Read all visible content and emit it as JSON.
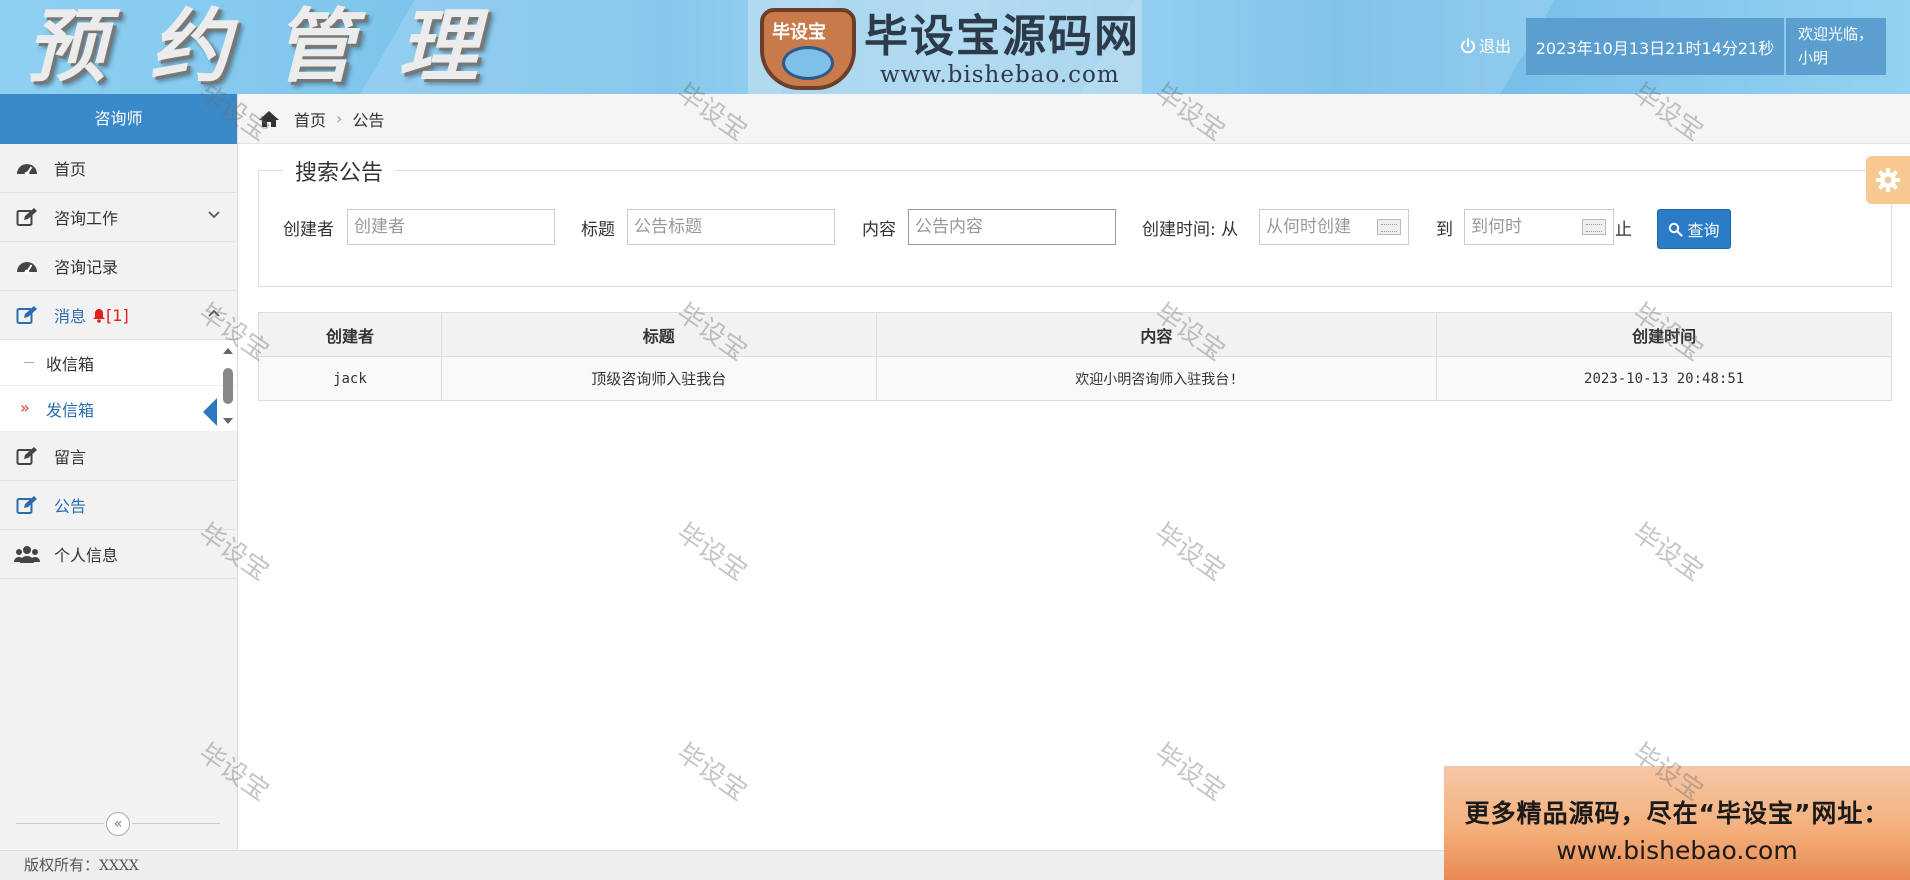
{
  "header": {
    "app_title": "预约管理",
    "logo_title": "毕设宝源码网",
    "logo_url": "www.bishebao.com",
    "logo_badge": "毕设宝",
    "logout_label": "退出",
    "datetime": "2023年10月13日21时14分21秒",
    "welcome": "欢迎光临，",
    "username": "小明"
  },
  "sidebar": {
    "role": "咨询师",
    "items": [
      {
        "label": "首页",
        "icon": "dashboard-icon"
      },
      {
        "label": "咨询工作",
        "icon": "edit-icon"
      },
      {
        "label": "咨询记录",
        "icon": "dashboard-icon"
      },
      {
        "label": "消息",
        "icon": "edit-icon",
        "badge": "[1]"
      },
      {
        "label": "留言",
        "icon": "edit-icon"
      },
      {
        "label": "公告",
        "icon": "edit-icon"
      },
      {
        "label": "个人信息",
        "icon": "users-icon"
      }
    ],
    "subitems": [
      {
        "label": "收信箱"
      },
      {
        "label": "发信箱"
      }
    ],
    "collapse_glyph": "«"
  },
  "breadcrumb": {
    "home": "首页",
    "separator": "›",
    "current": "公告"
  },
  "search": {
    "legend": "搜索公告",
    "creator_label": "创建者",
    "creator_placeholder": "创建者",
    "title_label": "标题",
    "title_placeholder": "公告标题",
    "content_label": "内容",
    "content_placeholder": "公告内容",
    "time_label": "创建时间: 从",
    "from_placeholder": "从何时创建",
    "to_label": "到",
    "to_placeholder": "到何时",
    "to_suffix": "止",
    "query_button": "查询"
  },
  "table": {
    "columns": [
      "创建者",
      "标题",
      "内容",
      "创建时间"
    ],
    "rows": [
      [
        "jack",
        "顶级咨询师入驻我台",
        "欢迎小明咨询师入驻我台!",
        "2023-10-13 20:48:51"
      ]
    ]
  },
  "footer": {
    "copyright_label": "版权所有：",
    "copyright_value": "XXXX"
  },
  "promo": {
    "line1": "更多精品源码，尽在“毕设宝”网址：",
    "line2": "www.bishebao.com"
  },
  "watermark": "毕设宝",
  "colors": {
    "accent": "#3a8ac9",
    "button": "#2a7cc7",
    "badge": "#e0201a",
    "header_bg": "#7cc4ec"
  }
}
